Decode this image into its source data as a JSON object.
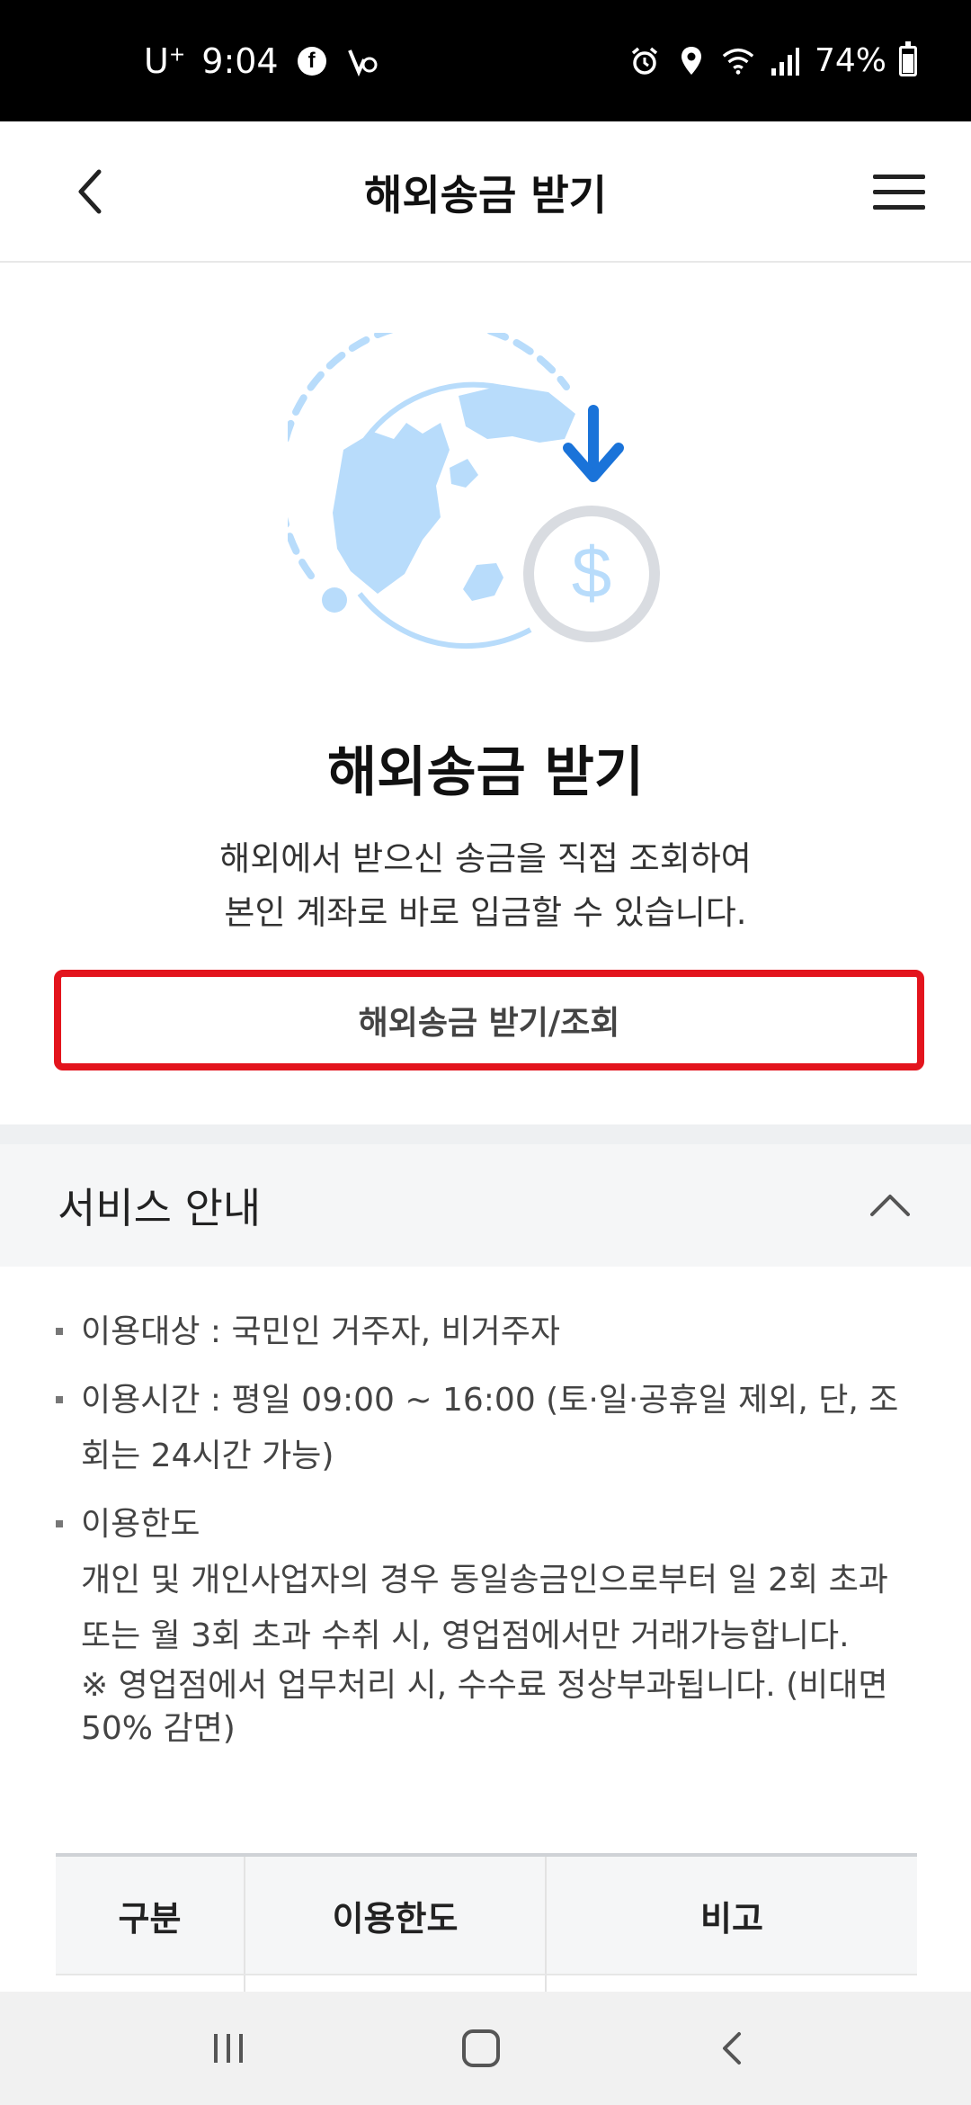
{
  "status_bar": {
    "carrier": "U",
    "carrier_sup": "+",
    "time": "9:04",
    "battery": "74%"
  },
  "header": {
    "title": "해외송금 받기"
  },
  "hero": {
    "title": "해외송금 받기",
    "desc_line1": "해외에서 받으신 송금을 직접 조회하여",
    "desc_line2": "본인 계좌로 바로 입금할 수 있습니다.",
    "button_label": "해외송금 받기/조회"
  },
  "service_info": {
    "title": "서비스 안내",
    "items": [
      {
        "text": "이용대상 : 국민인 거주자, 비거주자"
      },
      {
        "text": "이용시간 : 평일 09:00 ~ 16:00 (토·일·공휴일 제외, 단, 조회는 24시간 가능)"
      },
      {
        "heading": "이용한도",
        "body": "개인 및 개인사업자의 경우 동일송금인으로부터 일 2회 초과 또는 월 3회 초과 수취 시, 영업점에서만 거래가능합니다.",
        "note": "※ 영업점에서 업무처리 시, 수수료 정상부과됩니다. (비대면 50% 감면)"
      }
    ]
  },
  "table": {
    "headers": [
      "구분",
      "이용한도",
      "비고"
    ]
  },
  "colors": {
    "highlight": "#e3141d",
    "globe": "#b8dcfb",
    "arrow": "#1a73d9",
    "coin_ring": "#d9dce1"
  }
}
